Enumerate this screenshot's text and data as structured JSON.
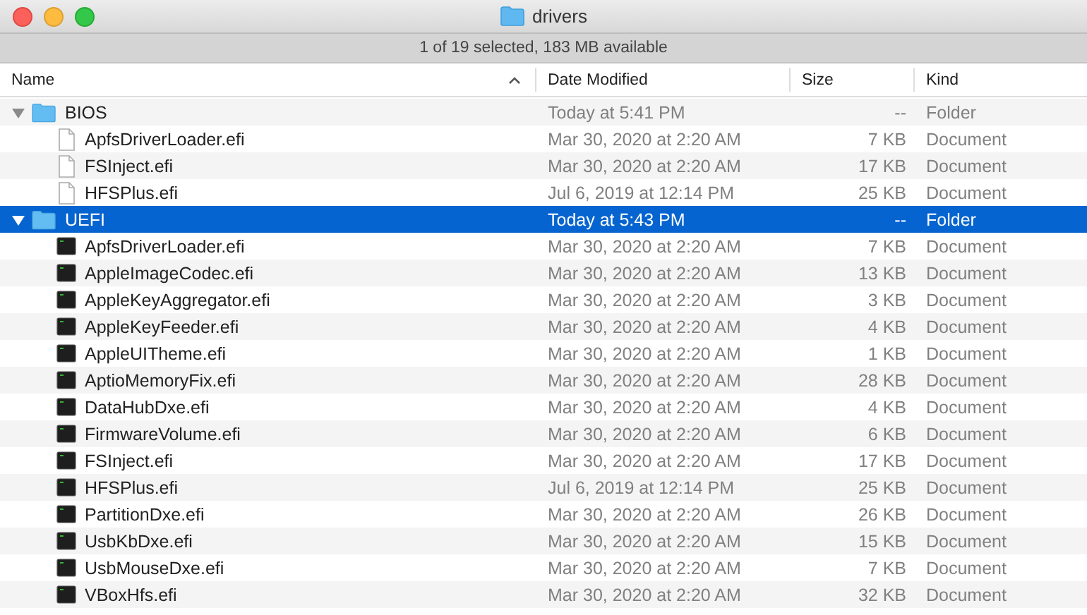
{
  "window": {
    "title": "drivers"
  },
  "status_bar": "1 of 19 selected, 183 MB available",
  "columns": [
    {
      "label": "Name",
      "sorted": true
    },
    {
      "label": "Date Modified",
      "sorted": false
    },
    {
      "label": "Size",
      "sorted": false
    },
    {
      "label": "Kind",
      "sorted": false
    }
  ],
  "rows": [
    {
      "kind": "folder",
      "name": "BIOS",
      "date": "Today at 5:41 PM",
      "size": "--",
      "type": "Folder",
      "expanded": true,
      "selected": false,
      "children": [
        {
          "kind": "document",
          "name": "ApfsDriverLoader.efi",
          "date": "Mar 30, 2020 at 2:20 AM",
          "size": "7 KB",
          "type": "Document",
          "selected": false
        },
        {
          "kind": "document",
          "name": "FSInject.efi",
          "date": "Mar 30, 2020 at 2:20 AM",
          "size": "17 KB",
          "type": "Document",
          "selected": false
        },
        {
          "kind": "document",
          "name": "HFSPlus.efi",
          "date": "Jul 6, 2019 at 12:14 PM",
          "size": "25 KB",
          "type": "Document",
          "selected": false
        }
      ]
    },
    {
      "kind": "folder",
      "name": "UEFI",
      "date": "Today at 5:43 PM",
      "size": "--",
      "type": "Folder",
      "expanded": true,
      "selected": true,
      "children": [
        {
          "kind": "executable",
          "name": "ApfsDriverLoader.efi",
          "date": "Mar 30, 2020 at 2:20 AM",
          "size": "7 KB",
          "type": "Document",
          "selected": false
        },
        {
          "kind": "executable",
          "name": "AppleImageCodec.efi",
          "date": "Mar 30, 2020 at 2:20 AM",
          "size": "13 KB",
          "type": "Document",
          "selected": false
        },
        {
          "kind": "executable",
          "name": "AppleKeyAggregator.efi",
          "date": "Mar 30, 2020 at 2:20 AM",
          "size": "3 KB",
          "type": "Document",
          "selected": false
        },
        {
          "kind": "executable",
          "name": "AppleKeyFeeder.efi",
          "date": "Mar 30, 2020 at 2:20 AM",
          "size": "4 KB",
          "type": "Document",
          "selected": false
        },
        {
          "kind": "executable",
          "name": "AppleUITheme.efi",
          "date": "Mar 30, 2020 at 2:20 AM",
          "size": "1 KB",
          "type": "Document",
          "selected": false
        },
        {
          "kind": "executable",
          "name": "AptioMemoryFix.efi",
          "date": "Mar 30, 2020 at 2:20 AM",
          "size": "28 KB",
          "type": "Document",
          "selected": false
        },
        {
          "kind": "executable",
          "name": "DataHubDxe.efi",
          "date": "Mar 30, 2020 at 2:20 AM",
          "size": "4 KB",
          "type": "Document",
          "selected": false
        },
        {
          "kind": "executable",
          "name": "FirmwareVolume.efi",
          "date": "Mar 30, 2020 at 2:20 AM",
          "size": "6 KB",
          "type": "Document",
          "selected": false
        },
        {
          "kind": "executable",
          "name": "FSInject.efi",
          "date": "Mar 30, 2020 at 2:20 AM",
          "size": "17 KB",
          "type": "Document",
          "selected": false
        },
        {
          "kind": "executable",
          "name": "HFSPlus.efi",
          "date": "Jul 6, 2019 at 12:14 PM",
          "size": "25 KB",
          "type": "Document",
          "selected": false
        },
        {
          "kind": "executable",
          "name": "PartitionDxe.efi",
          "date": "Mar 30, 2020 at 2:20 AM",
          "size": "26 KB",
          "type": "Document",
          "selected": false
        },
        {
          "kind": "executable",
          "name": "UsbKbDxe.efi",
          "date": "Mar 30, 2020 at 2:20 AM",
          "size": "15 KB",
          "type": "Document",
          "selected": false
        },
        {
          "kind": "executable",
          "name": "UsbMouseDxe.efi",
          "date": "Mar 30, 2020 at 2:20 AM",
          "size": "7 KB",
          "type": "Document",
          "selected": false
        },
        {
          "kind": "executable",
          "name": "VBoxHfs.efi",
          "date": "Mar 30, 2020 at 2:20 AM",
          "size": "32 KB",
          "type": "Document",
          "selected": false
        }
      ]
    }
  ]
}
